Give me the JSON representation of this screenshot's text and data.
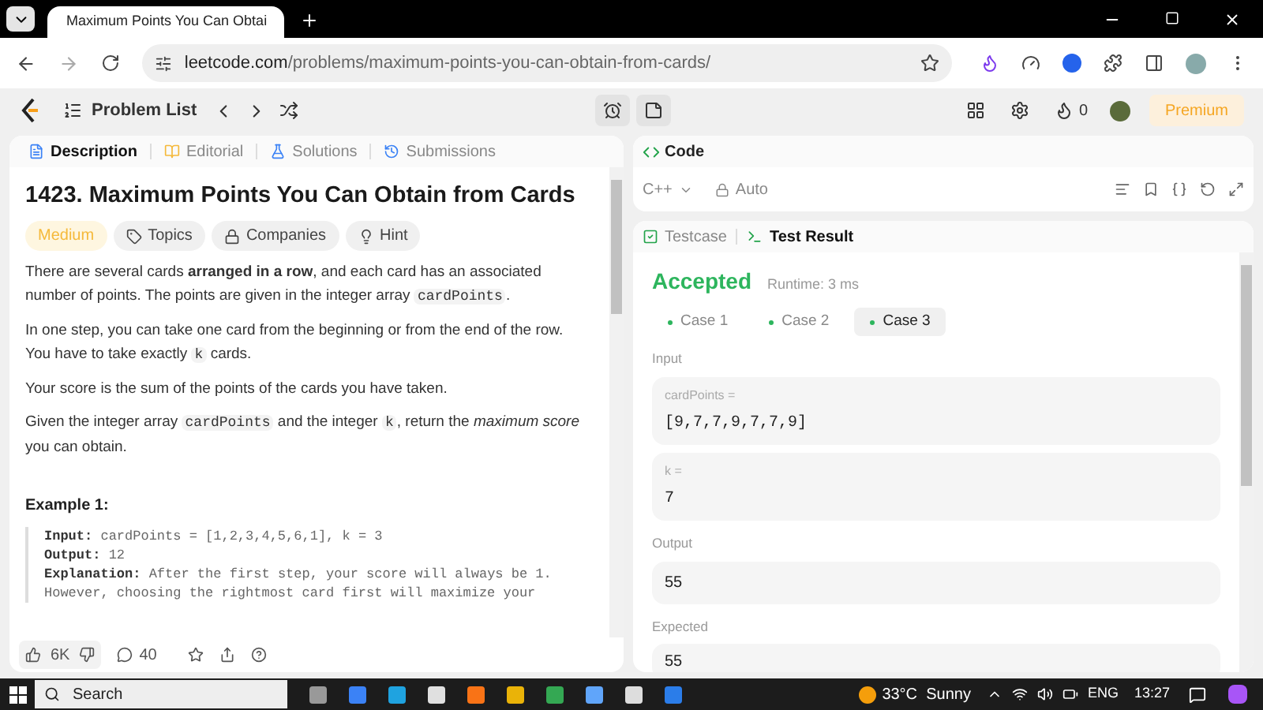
{
  "browser": {
    "tab_title": "Maximum Points You Can Obtai",
    "url_host": "leetcode.com",
    "url_path": "/problems/maximum-points-you-can-obtain-from-cards/"
  },
  "nav": {
    "problem_list": "Problem List",
    "streak": "0",
    "premium": "Premium"
  },
  "description_tabs": [
    {
      "label": "Description",
      "selected": true
    },
    {
      "label": "Editorial",
      "selected": false
    },
    {
      "label": "Solutions",
      "selected": false
    },
    {
      "label": "Submissions",
      "selected": false
    }
  ],
  "problem": {
    "title": "1423. Maximum Points You Can Obtain from Cards",
    "tags": [
      {
        "kind": "difficulty",
        "label": "Medium"
      },
      {
        "kind": "topics",
        "label": "Topics"
      },
      {
        "kind": "companies",
        "label": "Companies"
      },
      {
        "kind": "hint",
        "label": "Hint"
      }
    ],
    "paragraphs": [
      [
        {
          "kind": "text",
          "text": "There are several cards **arranged in a row**, and each card has an associated number of points. The points are given in the integer array "
        },
        {
          "kind": "code",
          "text": "cardPoints"
        },
        {
          "kind": "text",
          "text": "."
        }
      ],
      [
        {
          "kind": "text",
          "text": "In one step, you can take one card from the beginning or from the end of the row. You have to take exactly "
        },
        {
          "kind": "code",
          "text": "k"
        },
        {
          "kind": "text",
          "text": " cards."
        }
      ],
      [
        {
          "kind": "text",
          "text": "Your score is the sum of the points of the cards you have taken."
        }
      ],
      [
        {
          "kind": "text",
          "text": "Given the integer array "
        },
        {
          "kind": "code",
          "text": "cardPoints"
        },
        {
          "kind": "text",
          "text": " and the integer "
        },
        {
          "kind": "code",
          "text": "k"
        },
        {
          "kind": "text",
          "text": ", return the *maximum score* you can obtain."
        }
      ]
    ],
    "example": {
      "title": "Example 1:",
      "lines": [
        {
          "label": "Input:",
          "text": "cardPoints = [1,2,3,4,5,6,1], k = 3"
        },
        {
          "label": "Output:",
          "text": "12"
        },
        {
          "label": "Explanation:",
          "text": "After the first step, your score will always be 1."
        },
        {
          "text": "However, choosing the rightmost card first will maximize your"
        }
      ]
    }
  },
  "footer": {
    "likes": "6K",
    "comments": "40"
  },
  "code": {
    "title": "Code",
    "language": "C++",
    "mode": "Auto"
  },
  "result_tabs": [
    {
      "label": "Testcase",
      "selected": false
    },
    {
      "label": "Test Result",
      "selected": true
    }
  ],
  "result": {
    "status": "Accepted",
    "runtime": "Runtime: 3 ms",
    "cases": [
      {
        "label": "Case 1",
        "selected": false
      },
      {
        "label": "Case 2",
        "selected": false
      },
      {
        "label": "Case 3",
        "selected": true
      }
    ],
    "input_label": "Input",
    "params": [
      {
        "name": "cardPoints =",
        "value": "[9,7,7,9,7,7,9]"
      },
      {
        "name": "k =",
        "value": "7"
      }
    ],
    "output_label": "Output",
    "output": "55",
    "expected_label": "Expected",
    "expected": "55"
  },
  "taskbar": {
    "search": "Search",
    "weather": "33°C  Sunny",
    "language": "ENG",
    "time": "13:27"
  }
}
